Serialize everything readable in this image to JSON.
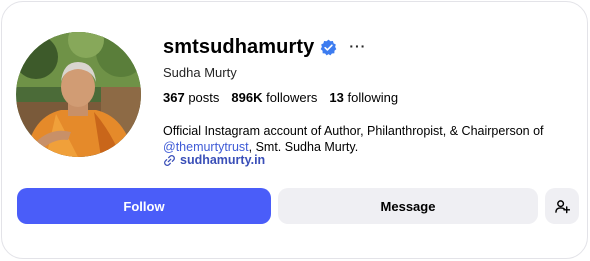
{
  "profile": {
    "username": "smtsudhamurty",
    "full_name": "Sudha Murty",
    "verified": true,
    "stats": {
      "posts_count": "367",
      "posts_label": "posts",
      "followers_count": "896K",
      "followers_label": "followers",
      "following_count": "13",
      "following_label": "following"
    },
    "bio": {
      "line1": "Official Instagram account of Author, Philanthropist, & Chairperson of",
      "mention": "@themurtytrust",
      "line2_rest": ", Smt. Sudha Murty."
    },
    "website": "sudhamurty.in"
  },
  "actions": {
    "more": "···",
    "follow": "Follow",
    "message": "Message"
  },
  "icons": {
    "verified": "verified-badge-icon",
    "link": "link-icon",
    "add_user": "add-user-icon",
    "more": "more-options-icon"
  },
  "colors": {
    "follow_button": "#4a5df9",
    "verified_badge": "#3d7cf0",
    "link": "#3f5bd6",
    "secondary_button": "#efeff3"
  }
}
